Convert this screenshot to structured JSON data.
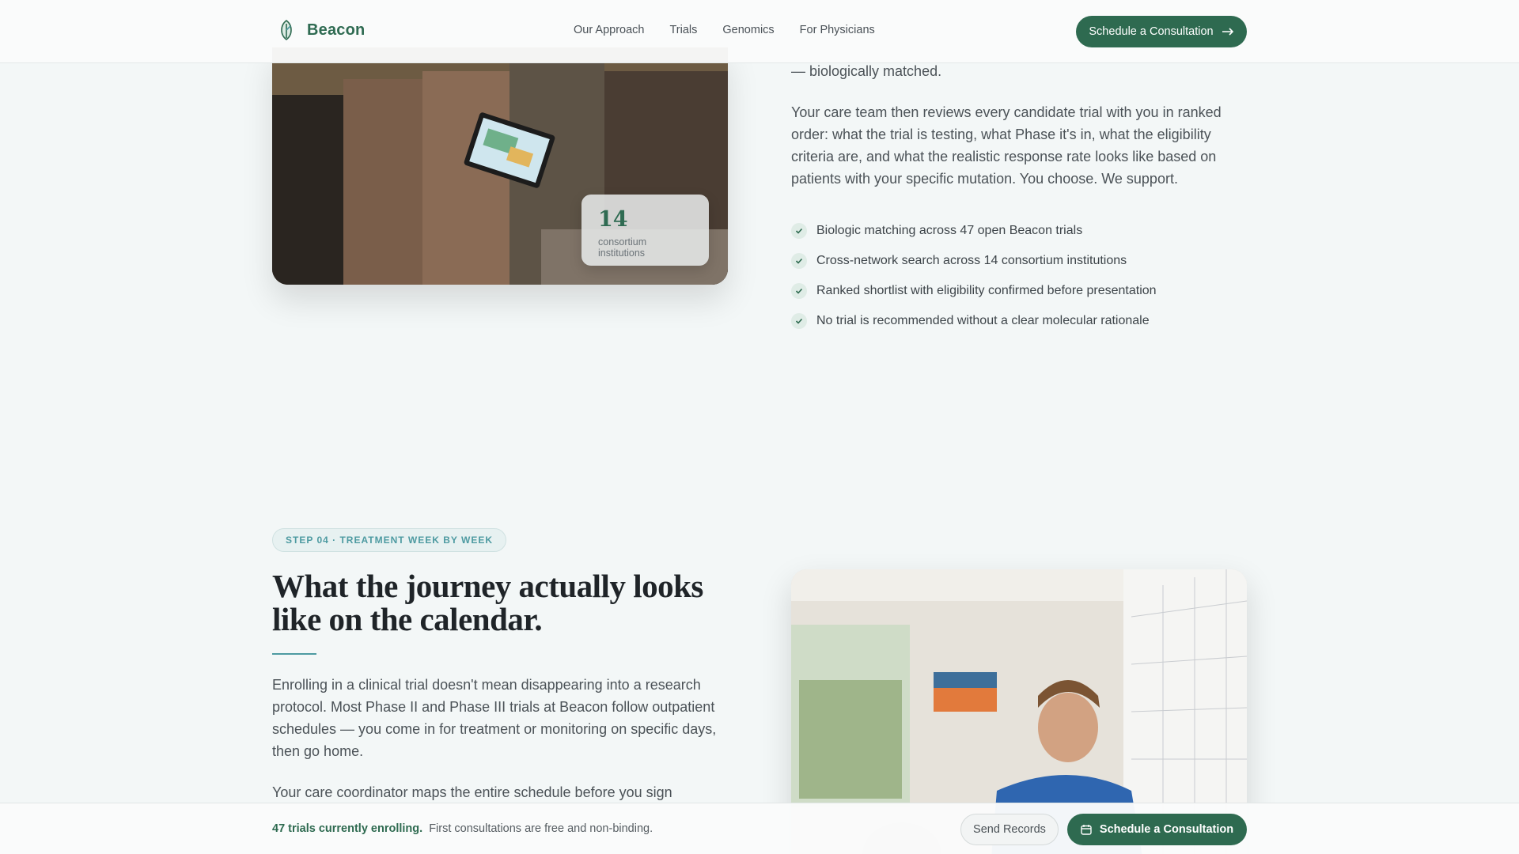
{
  "header": {
    "brand": "Beacon",
    "nav": [
      "Our Approach",
      "Trials",
      "Genomics",
      "For Physicians"
    ],
    "cta": "Schedule a Consultation"
  },
  "colors": {
    "brand_green": "#2e6a50",
    "accent_teal": "#4d9aa1",
    "background": "#f3f7f7"
  },
  "section_match": {
    "trailing_text": "— biologically matched.",
    "paragraph": "Your care team then reviews every candidate trial with you in ranked order: what the trial is testing, what Phase it's in, what the eligibility criteria are, and what the realistic response rate looks like based on patients with your specific mutation. You choose. We support.",
    "stat": {
      "value": "14",
      "label": "consortium institutions"
    },
    "checklist": [
      "Biologic matching across 47 open Beacon trials",
      "Cross-network search across 14 consortium institutions",
      "Ranked shortlist with eligibility confirmed before presentation",
      "No trial is recommended without a clear molecular rationale"
    ]
  },
  "section_calendar": {
    "badge": "STEP 04 · TREATMENT WEEK BY WEEK",
    "headline": "What the journey actually looks like on the calendar.",
    "paragraph1": "Enrolling in a clinical trial doesn't mean disappearing into a research protocol. Most Phase II and Phase III trials at Beacon follow outpatient schedules — you come in for treatment or monitoring on specific days, then go home.",
    "paragraph2": "Your care coordinator maps the entire schedule before you sign"
  },
  "bottom_bar": {
    "strong": "47 trials currently enrolling.",
    "text": "First consultations are free and non-binding.",
    "secondary_button": "Send Records",
    "primary_button": "Schedule a Consultation"
  },
  "icons": [
    "leaf-logo-icon",
    "arrow-right-icon",
    "check-icon",
    "calendar-icon"
  ]
}
